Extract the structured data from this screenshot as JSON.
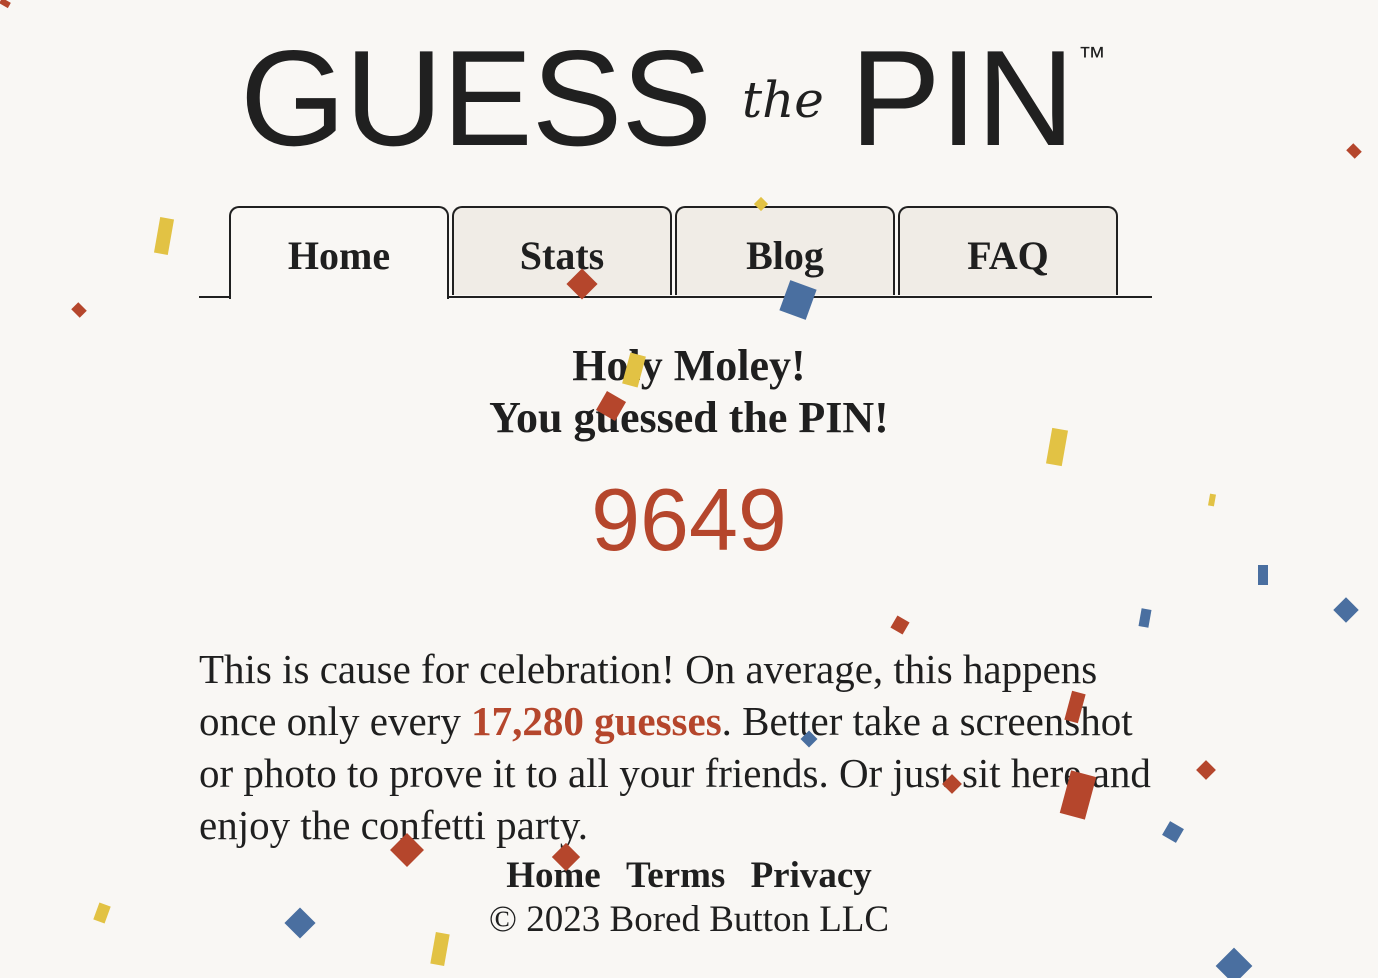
{
  "logo": {
    "word1": "GUESS",
    "word2": "the",
    "word3": "PIN",
    "trademark": "™"
  },
  "tabs": [
    {
      "label": "Home",
      "active": true
    },
    {
      "label": "Stats",
      "active": false
    },
    {
      "label": "Blog",
      "active": false
    },
    {
      "label": "FAQ",
      "active": false
    }
  ],
  "result": {
    "line1": "Holy Moley!",
    "line2": "You guessed the PIN!",
    "pin": "9649"
  },
  "message": {
    "before": "This is cause for celebration! On average, this happens once only every ",
    "highlight": "17,280 guesses",
    "after": ". Better take a screenshot or photo to prove it to all your friends. Or just sit here and enjoy the confetti party."
  },
  "footer": {
    "links": [
      "Home",
      "Terms",
      "Privacy"
    ],
    "copyright": "© 2023 Bored Button LLC"
  },
  "colors": {
    "accent": "#b5462c",
    "confetti_red": "#b5462c",
    "confetti_yellow": "#e2c244",
    "confetti_blue": "#4a6fa0",
    "background": "#f9f7f4",
    "tab_background": "#f0ece6"
  }
}
